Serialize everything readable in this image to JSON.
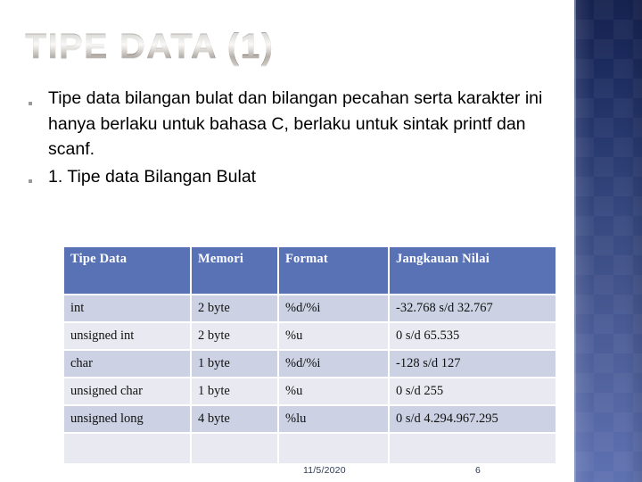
{
  "slide": {
    "title": "Tipe Data (1)",
    "bullets": [
      {
        "marker": "square-bullet",
        "text": "Tipe data bilangan bulat dan bilangan pecahan serta karakter ini hanya berlaku untuk bahasa C, berlaku untuk sintak printf dan scanf."
      },
      {
        "marker": "square-bullet",
        "text": "1. Tipe data Bilangan Bulat"
      }
    ],
    "table": {
      "headers": [
        "Tipe Data",
        "Memori",
        "Format",
        "Jangkauan Nilai"
      ],
      "rows": [
        [
          "int",
          "2 byte",
          "%d/%i",
          "-32.768 s/d 32.767"
        ],
        [
          "unsigned int",
          "2 byte",
          "%u",
          "0 s/d 65.535"
        ],
        [
          "char",
          "1 byte",
          "%d/%i",
          "-128 s/d 127"
        ],
        [
          "unsigned char",
          "1 byte",
          "%u",
          "0 s/d 255"
        ],
        [
          "unsigned long",
          "4 byte",
          "%lu",
          "0 s/d 4.294.967.295"
        ],
        [
          "",
          "",
          "",
          ""
        ]
      ]
    },
    "footer": {
      "date": "11/5/2020",
      "page_number": "6"
    },
    "colors": {
      "table_header_bg": "#5872b5",
      "row_odd_bg": "#ccd2e4",
      "row_even_bg": "#e9eaf1",
      "side_band_top": "#16224f",
      "side_band_bottom": "#5e71b0",
      "body_text": "#000000",
      "footer_text": "#2f3b52"
    }
  }
}
